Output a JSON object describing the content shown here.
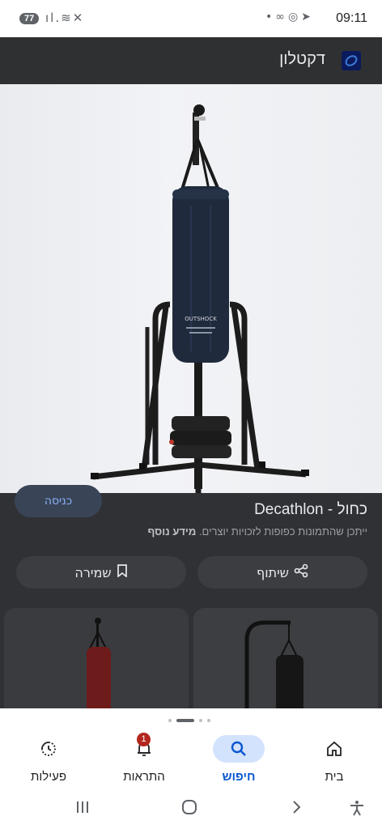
{
  "status_bar": {
    "time": "09:11",
    "battery_badge": "77",
    "left_icons": [
      "signal-icon",
      "wifi-icon",
      "mute-icon"
    ],
    "right_icons": [
      "telegram-icon",
      "whatsapp-icon",
      "voicemail-icon",
      "dot-icon"
    ]
  },
  "header": {
    "site_name": "דקטלון",
    "logo_icon": "decathlon-logo-icon",
    "background": "#2f3032"
  },
  "product_image": {
    "bag_label": "OUTSHOCK",
    "bag_color": "#1f2a3c"
  },
  "details": {
    "visit_button_label": "כניסה",
    "title": "כחול - Decathlon",
    "rights_text": "ייתכן שהתמונות כפופות לזכויות יוצרים.",
    "more_info_link": "מידע נוסף",
    "share_label": "שיתוף",
    "save_label": "שמירה"
  },
  "bottom_nav": {
    "items": [
      {
        "label": "בית",
        "icon": "home-icon",
        "active": false
      },
      {
        "label": "חיפוש",
        "icon": "search-icon",
        "active": true
      },
      {
        "label": "התראות",
        "icon": "bell-icon",
        "active": false,
        "badge": "1"
      },
      {
        "label": "פעילות",
        "icon": "activity-icon",
        "active": false
      }
    ]
  },
  "system_nav": [
    "recents-icon",
    "home-circle-icon",
    "back-icon",
    "accessibility-icon"
  ],
  "colors": {
    "accent": "#0b57d0",
    "accent_bg": "#d3e3fd",
    "badge": "#b3261e"
  }
}
